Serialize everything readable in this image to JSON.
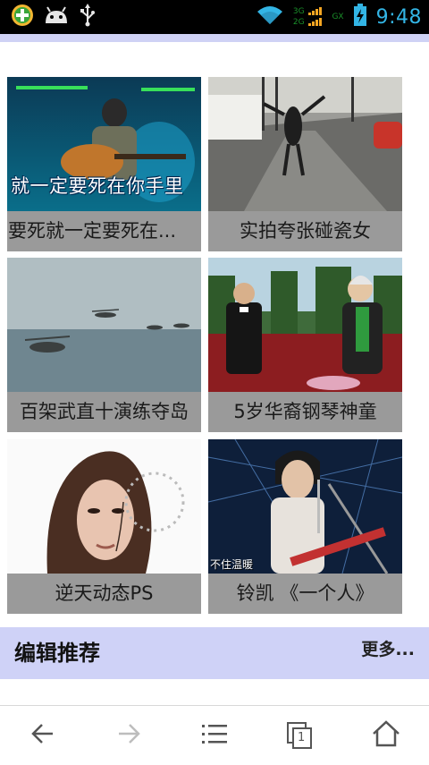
{
  "status_bar": {
    "time": "9:48",
    "left_icons": [
      "add-circle-icon",
      "android-icon",
      "usb-icon"
    ],
    "right_icons": [
      "wifi-icon",
      "signal-3g-icon",
      "signal-2g-icon",
      "signal-gx-icon",
      "battery-charging-icon"
    ],
    "net_labels": {
      "primary": "3G",
      "secondary": "2G",
      "tertiary": "GX"
    }
  },
  "videos": [
    {
      "title": "要死就一定要死在...",
      "overlay_text": "就一定要死在你手里"
    },
    {
      "title": "实拍夸张碰瓷女",
      "overlay_text": ""
    },
    {
      "title": "百架武直十演练夺岛",
      "overlay_text": ""
    },
    {
      "title": "5岁华裔钢琴神童",
      "overlay_text": ""
    },
    {
      "title": "逆天动态PS",
      "overlay_text": ""
    },
    {
      "title": "铃凯 《一个人》",
      "overlay_text": "不住温暖"
    }
  ],
  "section": {
    "title": "编辑推荐",
    "more_label": "更多..."
  },
  "bottom_nav": {
    "items": [
      "back-arrow-icon",
      "forward-arrow-icon",
      "menu-list-icon",
      "tabs-icon",
      "home-icon"
    ],
    "tab_count": "1"
  },
  "colors": {
    "status_time": "#33b5e5",
    "accent_band": "#cfd2f7",
    "caption_bg": "#9a9a9a"
  }
}
